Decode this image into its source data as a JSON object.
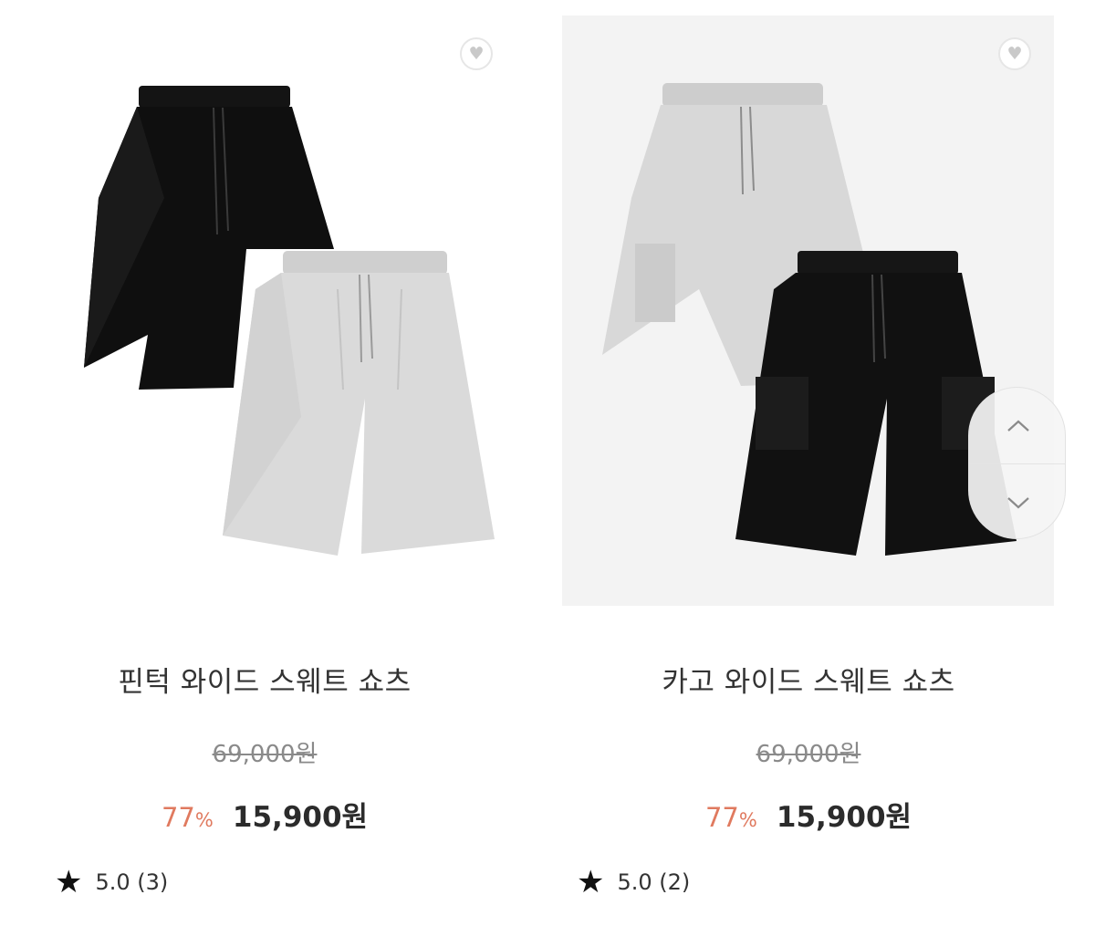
{
  "products": [
    {
      "name": "핀턱 와이드 스웨트 쇼츠",
      "original_price": "69,000원",
      "discount_value": "77",
      "discount_unit": "%",
      "sale_price": "15,900원",
      "rating": "5.0 (3)",
      "wishlist_icon": "heart-icon",
      "star_icon": "star-icon"
    },
    {
      "name": "카고 와이드 스웨트 쇼츠",
      "original_price": "69,000원",
      "discount_value": "77",
      "discount_unit": "%",
      "sale_price": "15,900원",
      "rating": "5.0 (2)",
      "wishlist_icon": "heart-icon",
      "star_icon": "star-icon"
    }
  ],
  "scroll_controls": {
    "up_icon": "chevron-up-icon",
    "down_icon": "chevron-down-icon"
  },
  "colors": {
    "discount": "#e07a5f",
    "black_shorts": "#111111",
    "gray_shorts": "#d9d9d9"
  }
}
